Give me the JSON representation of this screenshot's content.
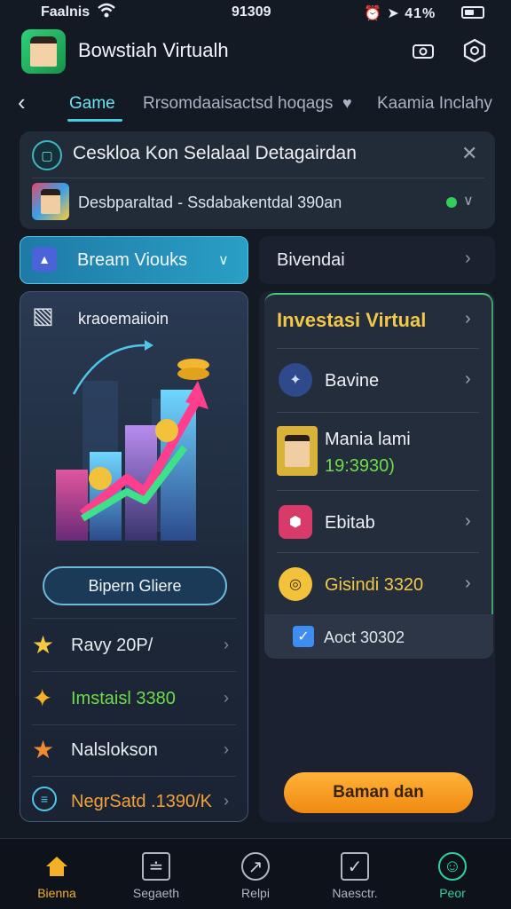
{
  "status_bar": {
    "carrier": "Faalnis",
    "time": "91309",
    "right": "⏰ ➤ 41%"
  },
  "header": {
    "title": "Bowstiah Virtualh",
    "icons": [
      "camera-icon",
      "settings-hex-icon"
    ]
  },
  "tabs": {
    "back_icon": "back-chevron-icon",
    "items": [
      {
        "label": "Game",
        "active": true
      },
      {
        "label": "Rrsomdaaisactsd hoqags",
        "active": false
      },
      {
        "label": "Kaamia Inclahy",
        "active": false
      }
    ]
  },
  "notice": {
    "title": "Ceskloa Kon Selalaal Detagairdan",
    "subtitle": "Desbparaltad  -  Ssdabakentdal 390an"
  },
  "dropdowns": {
    "left_label": "Bream Viouks",
    "right_label": "Bivendai"
  },
  "left_panel": {
    "title": "kraoemaiioin",
    "button_label": "Bipern Gliere",
    "rows": [
      {
        "label": "Ravy 20P/",
        "color": "#e8ecf3",
        "icon": "star-icon"
      },
      {
        "label": "Imstaisl 3380",
        "color": "#6fdc4a",
        "icon": "lightning-star-icon"
      },
      {
        "label": "Nalslokson",
        "color": "#e8ecf3",
        "icon": "fire-star-icon"
      },
      {
        "label": "NegrSatd .1390/K",
        "color": "#f2a238",
        "icon": "list-circle-icon"
      }
    ]
  },
  "right_panel": {
    "title": "Investasi Virtual",
    "items": [
      {
        "label": "Bavine",
        "icon": "badge-icon"
      },
      {
        "label": "Mania lami",
        "sub": "19:3930)",
        "icon": "avatar-icon"
      },
      {
        "label": "Ebitab",
        "icon": "hex-gem-icon"
      },
      {
        "label": "Gisindi 3320",
        "icon": "coin-icon"
      }
    ],
    "check_label": "Aoct 30302",
    "cta_label": "Baman dan"
  },
  "bottom_nav": [
    {
      "label": "Bienna",
      "active": true,
      "icon": "home-icon"
    },
    {
      "label": "Segaeth",
      "active": false,
      "icon": "chart-window-icon"
    },
    {
      "label": "Relpi",
      "active": false,
      "icon": "compass-icon"
    },
    {
      "label": "Naesctr.",
      "active": false,
      "icon": "shield-check-icon"
    },
    {
      "label": "Peor",
      "active": false,
      "icon": "profile-icon"
    }
  ],
  "colors": {
    "accent": "#49cfe3",
    "gold": "#f2c84a",
    "cta": "#f7a024",
    "nav_active": "#f5b02a",
    "profile_active": "#2fd0a0"
  }
}
